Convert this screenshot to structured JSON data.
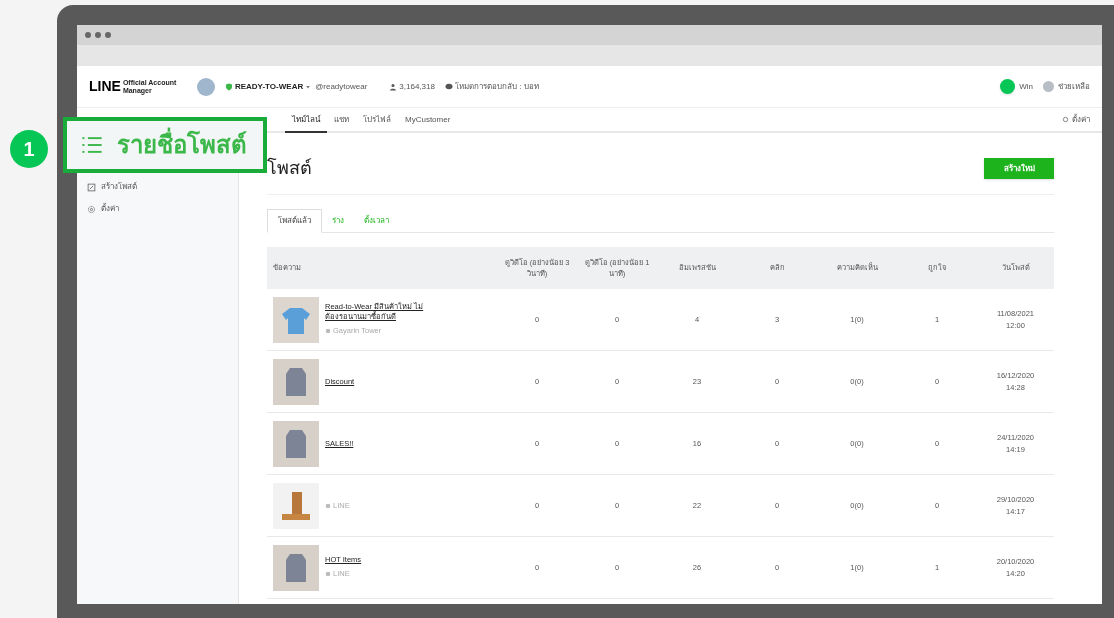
{
  "callout": {
    "number": "1",
    "label": "รายชื่อโพสต์"
  },
  "header": {
    "logo": "LINE",
    "logo_sub": "Official Account Manager",
    "account": "READY-TO-WEAR",
    "account_id": "@readytowear",
    "followers": "3,164,318",
    "mode": "โหมดการตอบกลับ : บอท",
    "user": "Win",
    "help": "ช่วยเหลือ"
  },
  "nav": {
    "tabs": [
      {
        "label": "ไทม์ไลน์",
        "selected": true
      },
      {
        "label": "แชท",
        "selected": false
      },
      {
        "label": "โปรไฟล์",
        "selected": false
      },
      {
        "label": "MyCustomer",
        "selected": false
      }
    ],
    "settings": "ตั้งค่า"
  },
  "sidebar": {
    "items": [
      {
        "label": "สร้างโพสต์",
        "kind": "create"
      },
      {
        "label": "ตั้งค่า",
        "kind": "settings"
      }
    ]
  },
  "page": {
    "title": "โพสต์",
    "create_button": "สร้างใหม่"
  },
  "post_tabs": [
    {
      "label": "โพสต์แล้ว",
      "selected": true
    },
    {
      "label": "ร่าง",
      "selected": false
    },
    {
      "label": "ตั้งเวลา",
      "selected": false
    }
  ],
  "table": {
    "columns": [
      "ข้อความ",
      "ดูวิดีโอ (อย่างน้อย 3 วินาที)",
      "ดูวิดีโอ (อย่างน้อย 1 นาที)",
      "อิมเพรสชัน",
      "คลิก",
      "ความคิดเห็น",
      "ถูกใจ",
      "วันโพสต์"
    ],
    "rows": [
      {
        "kind": "shirt",
        "title": "Read-to-Wear มีสินค้าใหม่ ไม่ต้องรอนานมาซื้อกันดี",
        "author": "Gayarin Tower",
        "video_3s": "0",
        "video_1m": "0",
        "impressions": "4",
        "clicks": "3",
        "comments": "1(0)",
        "likes": "1",
        "date": "11/08/2021",
        "time": "12:00"
      },
      {
        "kind": "jacket",
        "title": "Discount",
        "video_3s": "0",
        "video_1m": "0",
        "impressions": "23",
        "clicks": "0",
        "comments": "0(0)",
        "likes": "0",
        "date": "16/12/2020",
        "time": "14:28"
      },
      {
        "kind": "jacket",
        "title": "SALES!!",
        "video_3s": "0",
        "video_1m": "0",
        "impressions": "16",
        "clicks": "0",
        "comments": "0(0)",
        "likes": "0",
        "date": "24/11/2020",
        "time": "14:19"
      },
      {
        "kind": "shelf",
        "author": "LINE",
        "video_3s": "0",
        "video_1m": "0",
        "impressions": "22",
        "clicks": "0",
        "comments": "0(0)",
        "likes": "0",
        "date": "29/10/2020",
        "time": "14:17"
      },
      {
        "kind": "jacket",
        "title": "HOT Items",
        "author": "LINE",
        "video_3s": "0",
        "video_1m": "0",
        "impressions": "26",
        "clicks": "0",
        "comments": "1(0)",
        "likes": "1",
        "date": "20/10/2020",
        "time": "14:20"
      }
    ]
  }
}
